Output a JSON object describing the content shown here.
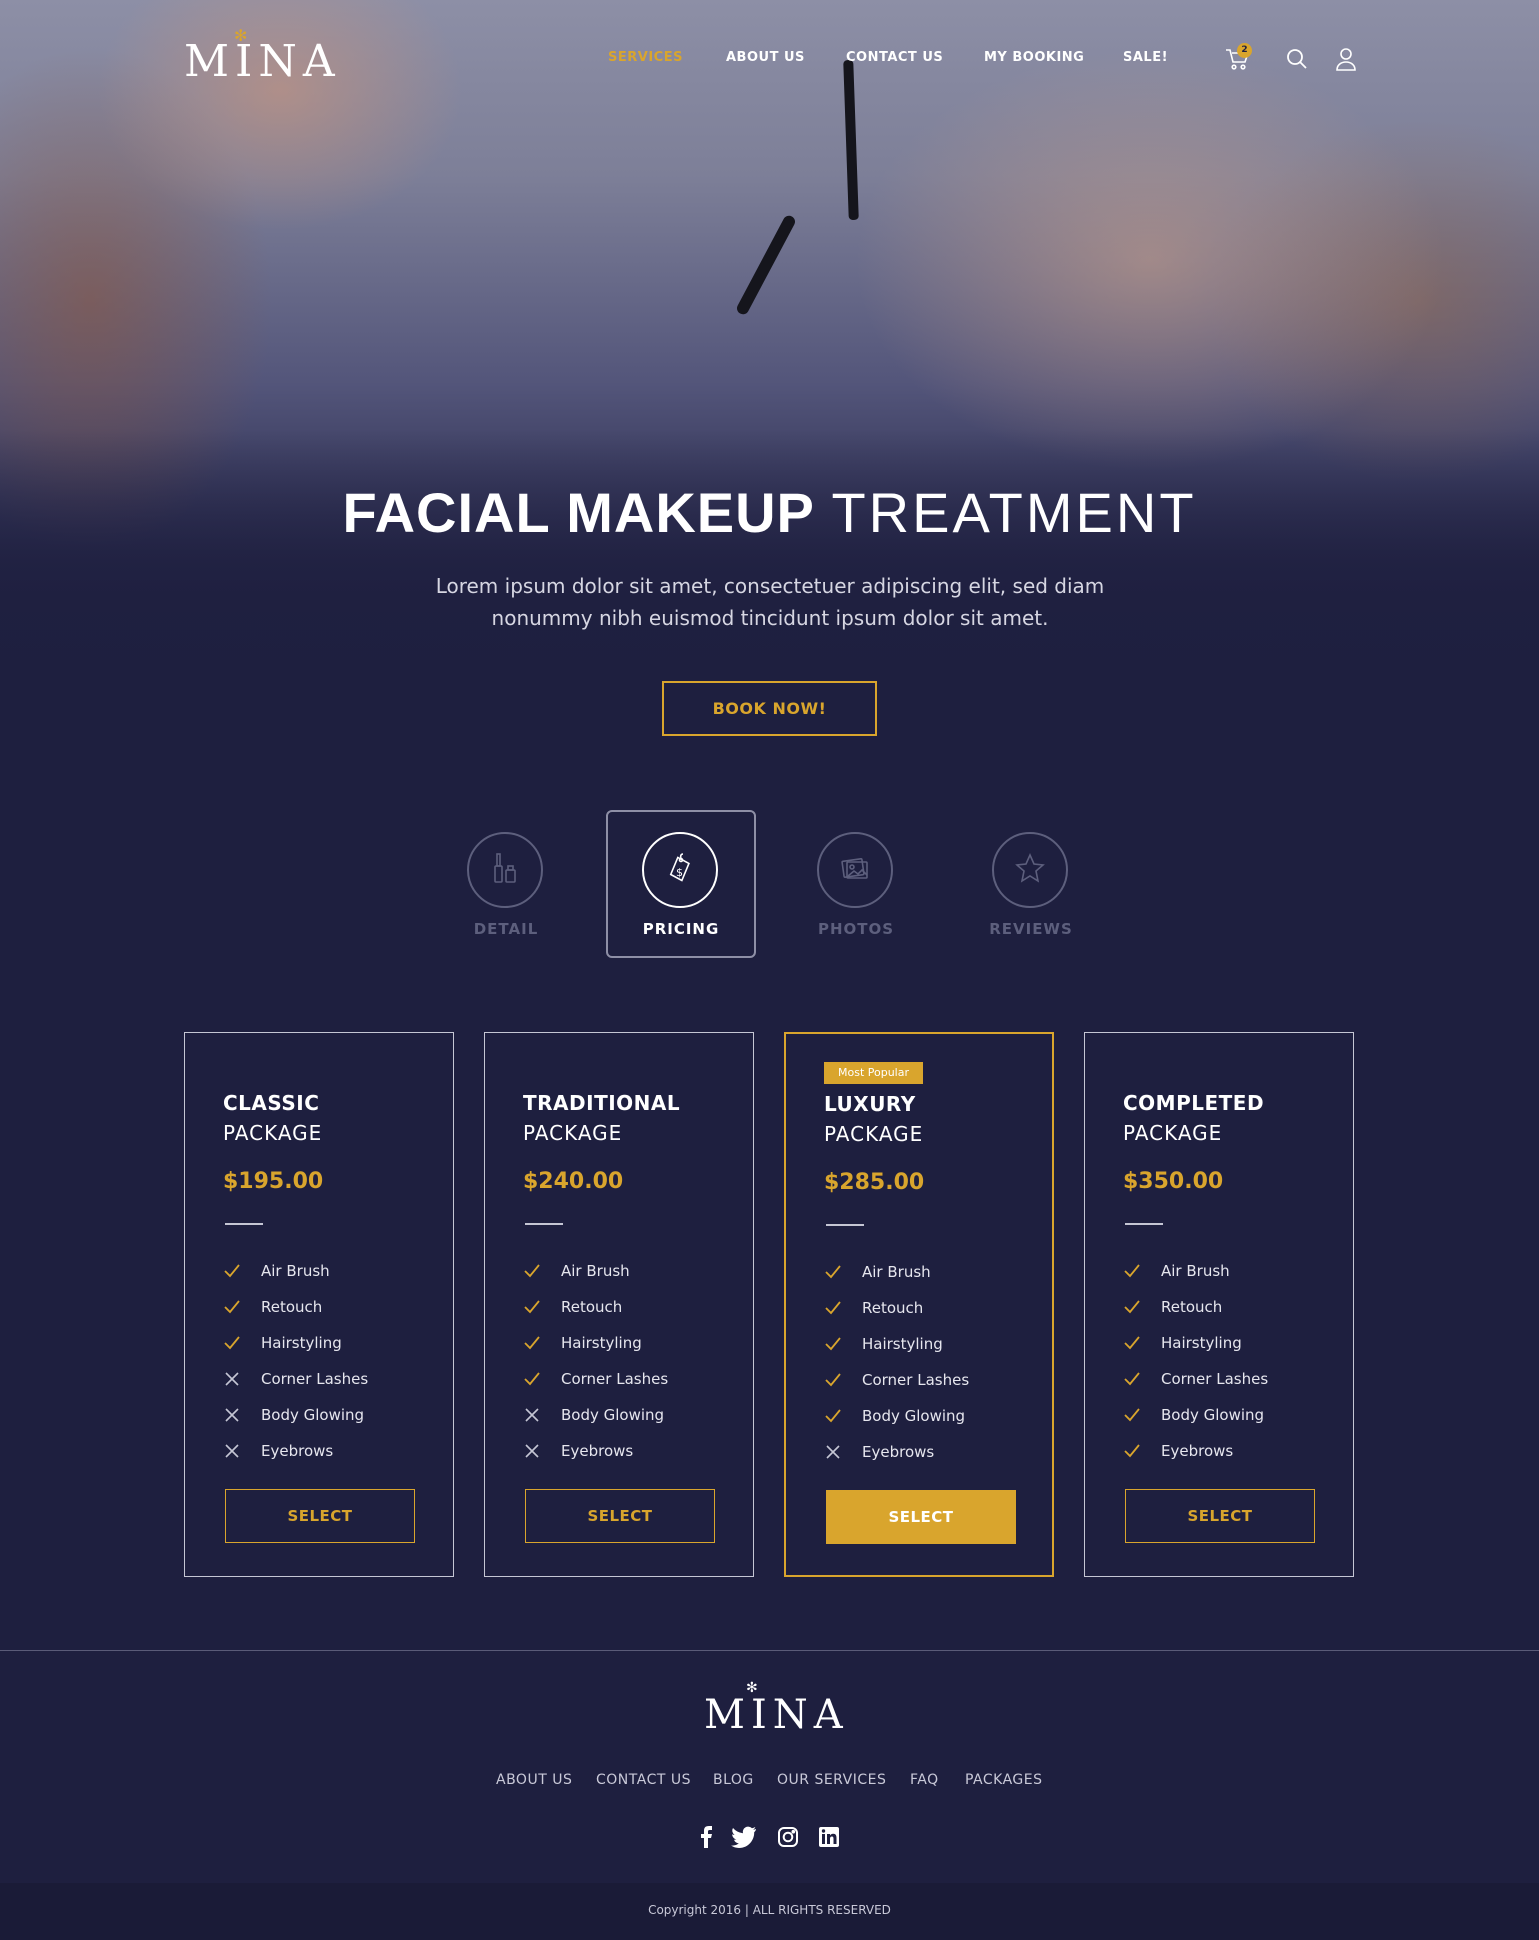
{
  "brand": {
    "name": "MINA"
  },
  "nav": {
    "items": [
      {
        "label": "SERVICES",
        "active": true
      },
      {
        "label": "ABOUT US"
      },
      {
        "label": "CONTACT US"
      },
      {
        "label": "MY BOOKING"
      },
      {
        "label": "SALE!"
      }
    ],
    "cart_count": "2"
  },
  "hero": {
    "title_bold": "FACIAL MAKEUP",
    "title_light": "TREATMENT",
    "desc_line1": "Lorem ipsum dolor sit amet, consectetuer adipiscing elit, sed diam",
    "desc_line2": "nonummy nibh euismod tincidunt ipsum dolor sit amet.",
    "cta": "BOOK NOW!"
  },
  "tabs": [
    {
      "label": "DETAIL",
      "icon": "mascara-icon"
    },
    {
      "label": "PRICING",
      "icon": "price-tag-icon",
      "active": true
    },
    {
      "label": "PHOTOS",
      "icon": "photos-icon"
    },
    {
      "label": "REVIEWS",
      "icon": "star-icon"
    }
  ],
  "packages": [
    {
      "name": "CLASSIC",
      "sub": "PACKAGE",
      "price": "$195.00",
      "badge": "",
      "features": [
        {
          "label": "Air Brush",
          "included": true
        },
        {
          "label": "Retouch",
          "included": true
        },
        {
          "label": "Hairstyling",
          "included": true
        },
        {
          "label": "Corner Lashes",
          "included": false
        },
        {
          "label": "Body Glowing",
          "included": false
        },
        {
          "label": "Eyebrows",
          "included": false
        }
      ],
      "button": "SELECT"
    },
    {
      "name": "TRADITIONAL",
      "sub": "PACKAGE",
      "price": "$240.00",
      "badge": "",
      "features": [
        {
          "label": "Air Brush",
          "included": true
        },
        {
          "label": "Retouch",
          "included": true
        },
        {
          "label": "Hairstyling",
          "included": true
        },
        {
          "label": "Corner Lashes",
          "included": true
        },
        {
          "label": "Body Glowing",
          "included": false
        },
        {
          "label": "Eyebrows",
          "included": false
        }
      ],
      "button": "SELECT"
    },
    {
      "name": "LUXURY",
      "sub": "PACKAGE",
      "price": "$285.00",
      "badge": "Most Popular",
      "features": [
        {
          "label": "Air Brush",
          "included": true
        },
        {
          "label": "Retouch",
          "included": true
        },
        {
          "label": "Hairstyling",
          "included": true
        },
        {
          "label": "Corner Lashes",
          "included": true
        },
        {
          "label": "Body Glowing",
          "included": true
        },
        {
          "label": "Eyebrows",
          "included": false
        }
      ],
      "button": "SELECT"
    },
    {
      "name": "COMPLETED",
      "sub": "PACKAGE",
      "price": "$350.00",
      "badge": "",
      "features": [
        {
          "label": "Air Brush",
          "included": true
        },
        {
          "label": "Retouch",
          "included": true
        },
        {
          "label": "Hairstyling",
          "included": true
        },
        {
          "label": "Corner Lashes",
          "included": true
        },
        {
          "label": "Body Glowing",
          "included": true
        },
        {
          "label": "Eyebrows",
          "included": true
        }
      ],
      "button": "SELECT"
    }
  ],
  "footer": {
    "links": [
      "ABOUT US",
      "CONTACT US",
      "BLOG",
      "OUR SERVICES",
      "FAQ",
      "PACKAGES"
    ],
    "social": [
      "facebook-icon",
      "twitter-icon",
      "instagram-icon",
      "linkedin-icon"
    ],
    "copyright": "Copyright 2016 | ALL RIGHTS RESERVED"
  },
  "colors": {
    "accent": "#d9a52d",
    "background": "#1e1f3f",
    "muted": "#5d5f7d",
    "copyright_bar": "#1a1b37"
  }
}
